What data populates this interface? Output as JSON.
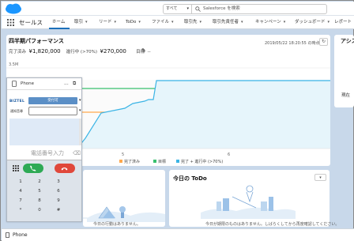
{
  "header": {
    "search_scope": "すべて",
    "search_placeholder": "Salesforce を検索"
  },
  "nav": {
    "app_name": "セールス",
    "tabs": [
      {
        "label": "ホーム",
        "has_menu": false
      },
      {
        "label": "取引",
        "has_menu": true
      },
      {
        "label": "リード",
        "has_menu": true
      },
      {
        "label": "ToDo",
        "has_menu": true
      },
      {
        "label": "ファイル",
        "has_menu": true
      },
      {
        "label": "取引先",
        "has_menu": true
      },
      {
        "label": "取引先責任者",
        "has_menu": true
      },
      {
        "label": "キャンペーン",
        "has_menu": true
      },
      {
        "label": "ダッシュボード",
        "has_menu": true
      },
      {
        "label": "レポート",
        "has_menu": false
      }
    ]
  },
  "performance": {
    "title": "四半期パフォーマンス",
    "timestamp": "2019/05/22 18:20:55 の時点",
    "closed_label": "完了済み",
    "closed_value": "¥1,820,000",
    "open_label": "進行中 (>70%)",
    "open_value": "¥270,000",
    "goal_label": "目標",
    "goal_value": "--"
  },
  "right_panel": {
    "title": "アシス",
    "subtitle": "現在"
  },
  "chart_data": {
    "type": "line",
    "ylabel_tick": "3.5M",
    "x_ticks": [
      "5",
      "6"
    ],
    "legend": [
      {
        "name": "完了済み",
        "color": "#ffa94d"
      },
      {
        "name": "目標",
        "color": "#38c06e"
      },
      {
        "name": "完了 + 進行中 (>70%)",
        "color": "#3bb4e5"
      }
    ]
  },
  "phone": {
    "header_label": "Phone",
    "menu_glyph": "...",
    "brand": "BIZTEL",
    "status": "受付可",
    "notify_label": "通知音尋",
    "dial_placeholder": "電話番号入力",
    "keys": [
      "1",
      "2",
      "3",
      "4",
      "5",
      "6",
      "7",
      "8",
      "9",
      "*",
      "0",
      "#"
    ]
  },
  "todo": {
    "title": "今日の ToDo",
    "empty_text": "今日が期限のものはありません。しばらくしてから再度確認してください。"
  },
  "events": {
    "empty_text": "今日の行動はありません。"
  },
  "utility_bar": {
    "label": "Phone"
  },
  "colors": {
    "brand_blue": "#1b96ff",
    "active_tab": "#1b6fb9",
    "call_green": "#2eaa55",
    "hangup_red": "#e0483b"
  }
}
